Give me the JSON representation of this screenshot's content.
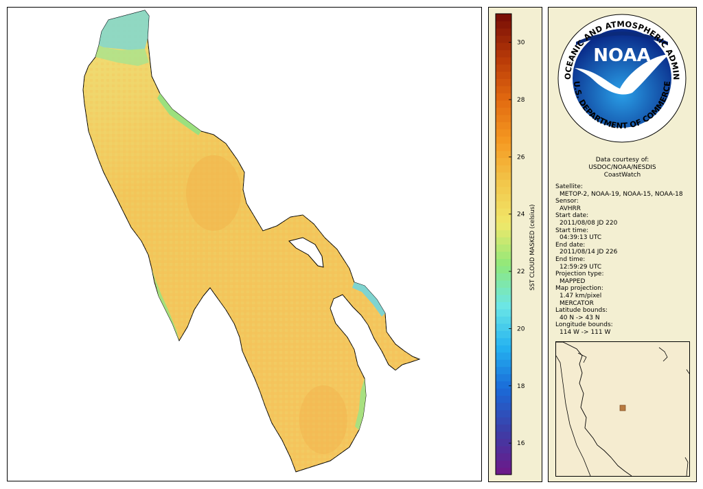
{
  "legend": {
    "title": "SST CLOUD MASKED (celsius)",
    "ticks": [
      "30",
      "28",
      "26",
      "24",
      "22",
      "20",
      "18",
      "16"
    ],
    "tick_values": [
      30,
      28,
      26,
      24,
      22,
      20,
      18,
      16
    ],
    "range": [
      14.9,
      31.0
    ],
    "colors": [
      "#6b1a8a",
      "#3b3fa8",
      "#1a6ad8",
      "#24b2f0",
      "#6be6e6",
      "#8fe87a",
      "#f0e86a",
      "#f2c64a",
      "#f59a22",
      "#e26a10",
      "#b83a08",
      "#7a0f06"
    ]
  },
  "logo": {
    "center_text": "NOAA",
    "ring_top": "NATIONAL OCEANIC AND ATMOSPHERIC ADMINISTRATION",
    "ring_bottom": "U.S. DEPARTMENT OF COMMERCE"
  },
  "courtesy": {
    "line1": "Data courtesy of:",
    "line2": "USDOC/NOAA/NESDIS",
    "line3": "CoastWatch"
  },
  "metadata": [
    {
      "label": "Satellite:",
      "value": "METOP-2, NOAA-19, NOAA-15, NOAA-18"
    },
    {
      "label": "Sensor:",
      "value": "AVHRR"
    },
    {
      "label": "Start date:",
      "value": "2011/08/08 JD 220"
    },
    {
      "label": "Start time:",
      "value": "04:39:13 UTC"
    },
    {
      "label": "End date:",
      "value": "2011/08/14 JD 226"
    },
    {
      "label": "End time:",
      "value": "12:59:29 UTC"
    },
    {
      "label": "Projection type:",
      "value": "MAPPED"
    },
    {
      "label": "Map projection:",
      "value": "1.47 km/pixel",
      "value2": "MERCATOR"
    },
    {
      "label": "Latitude bounds:",
      "value": "40 N -> 43 N"
    },
    {
      "label": "Longitude bounds:",
      "value": "114 W -> 111 W"
    }
  ],
  "map": {
    "water_base_color": "#f2cf62",
    "coastline_color": "#000000",
    "edge_color": "#9be07a"
  }
}
